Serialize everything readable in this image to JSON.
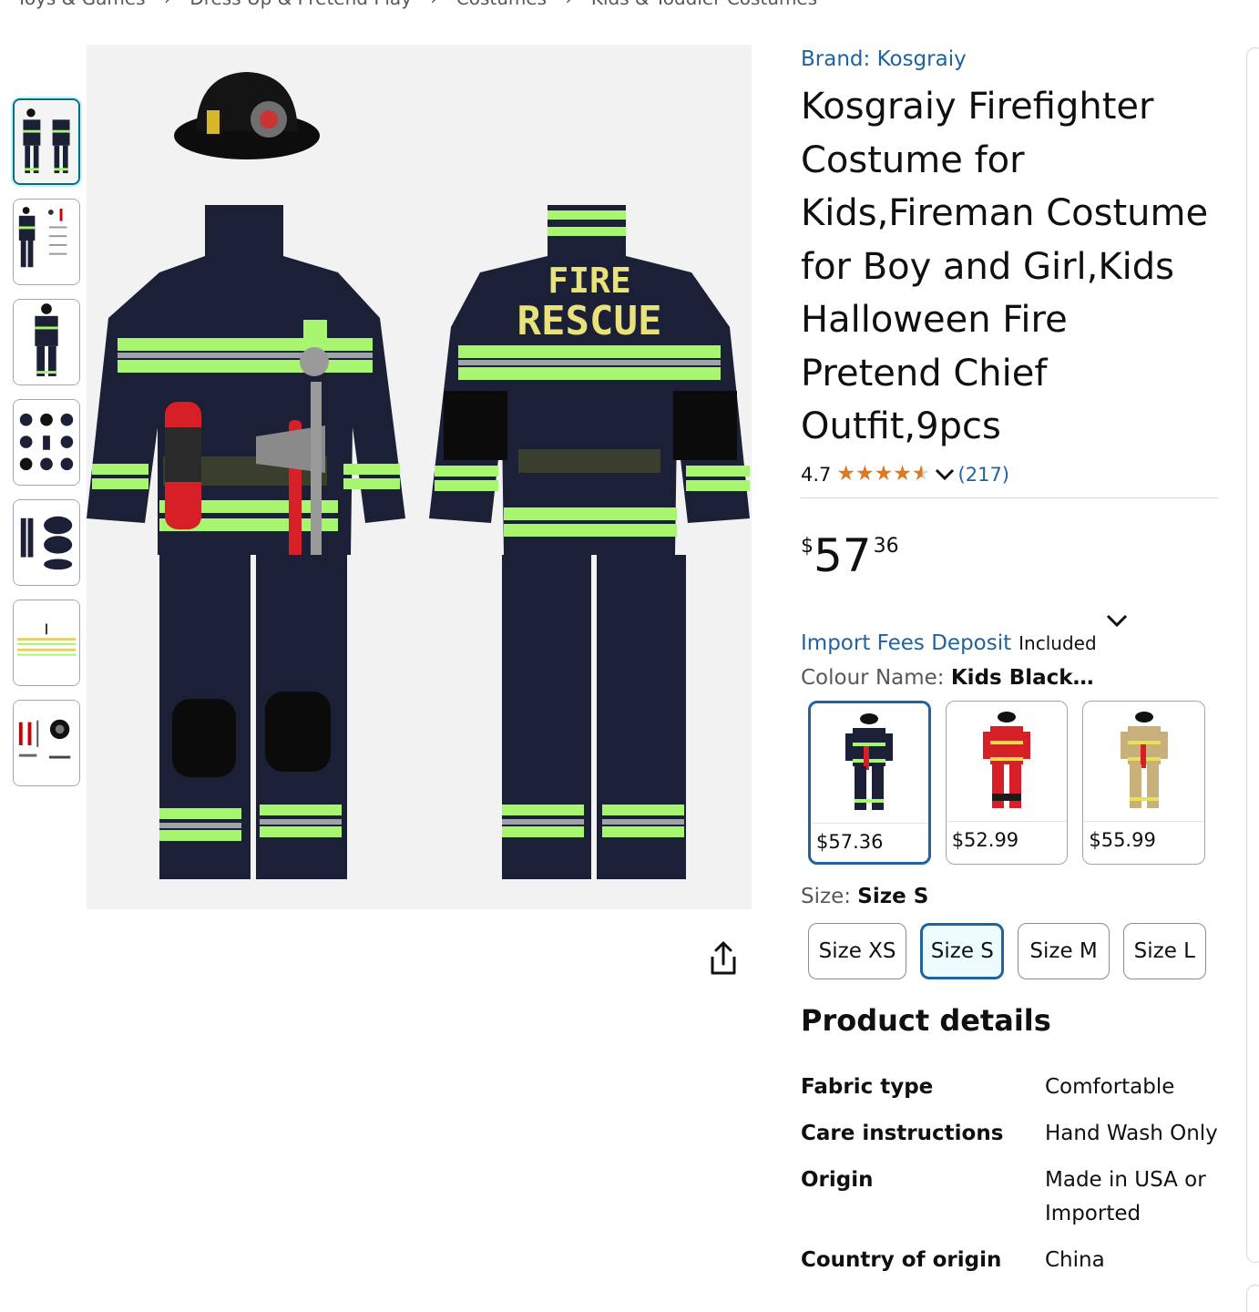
{
  "breadcrumb": [
    "Toys & Games",
    "›",
    "Dress Up & Pretend Play",
    "›",
    "Costumes",
    "›",
    "Kids & Toddler Costumes"
  ],
  "thumbnails": [
    {
      "name": "front-back-view"
    },
    {
      "name": "accessories-view"
    },
    {
      "name": "front-view"
    },
    {
      "name": "grid-view"
    },
    {
      "name": "pants-helmet-view"
    },
    {
      "name": "size-chart-view"
    },
    {
      "name": "tools-view"
    }
  ],
  "main_image": {
    "back_text_line1": "FIRE",
    "back_text_line2": "RESCUE"
  },
  "product": {
    "brand": "Brand: Kosgraiy",
    "title": "Kosgraiy Firefighter Costume for Kids,Fireman Costume for Boy and Girl,Kids Halloween Fire Pretend Chief Outfit,9pcs",
    "rating": "4.7",
    "rating_value": 4.7,
    "reviews": "(217)",
    "price_symbol": "$",
    "price_whole": "57",
    "price_fraction": "36",
    "import_link": "Import Fees Deposit",
    "import_included": "Included",
    "colour_label": "Colour Name: ",
    "colour_value": "Kids Black…",
    "size_label": "Size: ",
    "size_value": "Size S"
  },
  "colours": [
    {
      "price": "$57.36",
      "color": "#1b2036",
      "accent": "#9cf06b"
    },
    {
      "price": "$52.99",
      "color": "#d61f26",
      "accent": "#f7d84a"
    },
    {
      "price": "$55.99",
      "color": "#c9b07a",
      "accent": "#e5e15a"
    }
  ],
  "sizes": [
    "Size XS",
    "Size S",
    "Size M",
    "Size L"
  ],
  "details_heading": "Product details",
  "details": [
    {
      "key": "Fabric type",
      "value": "Comfortable"
    },
    {
      "key": "Care instructions",
      "value": "Hand Wash Only"
    },
    {
      "key": "Origin",
      "value": "Made in USA or Imported"
    },
    {
      "key": "Country of origin",
      "value": "China"
    }
  ],
  "colors": {
    "link": "#2162a1",
    "star": "#de7921",
    "selected_border": "#2162a1",
    "navy": "#1b2036",
    "reflective": "#a8f56f"
  }
}
